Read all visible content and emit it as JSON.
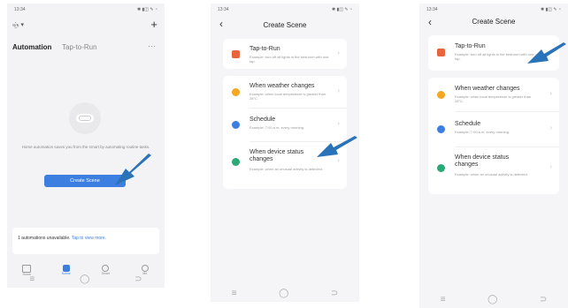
{
  "screen1": {
    "status_time": "13:34",
    "status_icons": "✱ ▮◫ ✎ ◔",
    "home_name": "ஞ் ▾",
    "tabs": [
      "Automation",
      "Tap-to-Run"
    ],
    "more": "···",
    "add": "+",
    "empty_text": "Home automation saves you from the smart by automating routine tasks.",
    "create_button": "Create Scene",
    "banner_bold": "1 automations unavailable.",
    "banner_link": "Tap to view more.",
    "bottom_tabs": [
      "Home",
      "Scene",
      "Smart",
      "Me"
    ],
    "nav": [
      "≡",
      "◯",
      "⊃"
    ]
  },
  "screen2": {
    "status_time": "13:34",
    "status_icons": "✱ ▮◫ ✎ ◔",
    "back": "‹",
    "title": "Create Scene",
    "options": [
      {
        "title": "Tap-to-Run",
        "desc": "Example: turn off all lights in the bedroom with one tap."
      },
      {
        "title": "When weather changes",
        "desc": "Example: when local temperature is greater than 28°C."
      },
      {
        "title": "Schedule",
        "desc": "Example: 7:00 a.m. every morning."
      },
      {
        "title": "When device status changes",
        "desc": "Example: when an unusual activity is detected."
      }
    ],
    "chev": "›",
    "nav": [
      "≡",
      "◯",
      "⊃"
    ]
  },
  "screen3": {
    "status_time": "13:34",
    "status_icons": "✱ ▮◫ ✎ ◔",
    "back": "‹",
    "title": "Create Scene",
    "options": [
      {
        "title": "Tap-to-Run",
        "desc": "Example: turn off all lights in the bedroom with one tap."
      },
      {
        "title": "When weather changes",
        "desc": "Example: when local temperature is greater than 28°C."
      },
      {
        "title": "Schedule",
        "desc": "Example: 7:00 a.m. every morning."
      },
      {
        "title": "When device status changes",
        "desc": "Example: when an unusual activity is detected."
      }
    ],
    "chev": "›",
    "nav": [
      "≡",
      "◯",
      "⊃"
    ]
  },
  "colors": {
    "accent": "#3d7fe0",
    "arrow": "#2b73b8",
    "sun": "#f5a623",
    "schedule": "#3d7fe0",
    "device": "#2aa876",
    "tap": "#e8643c"
  }
}
